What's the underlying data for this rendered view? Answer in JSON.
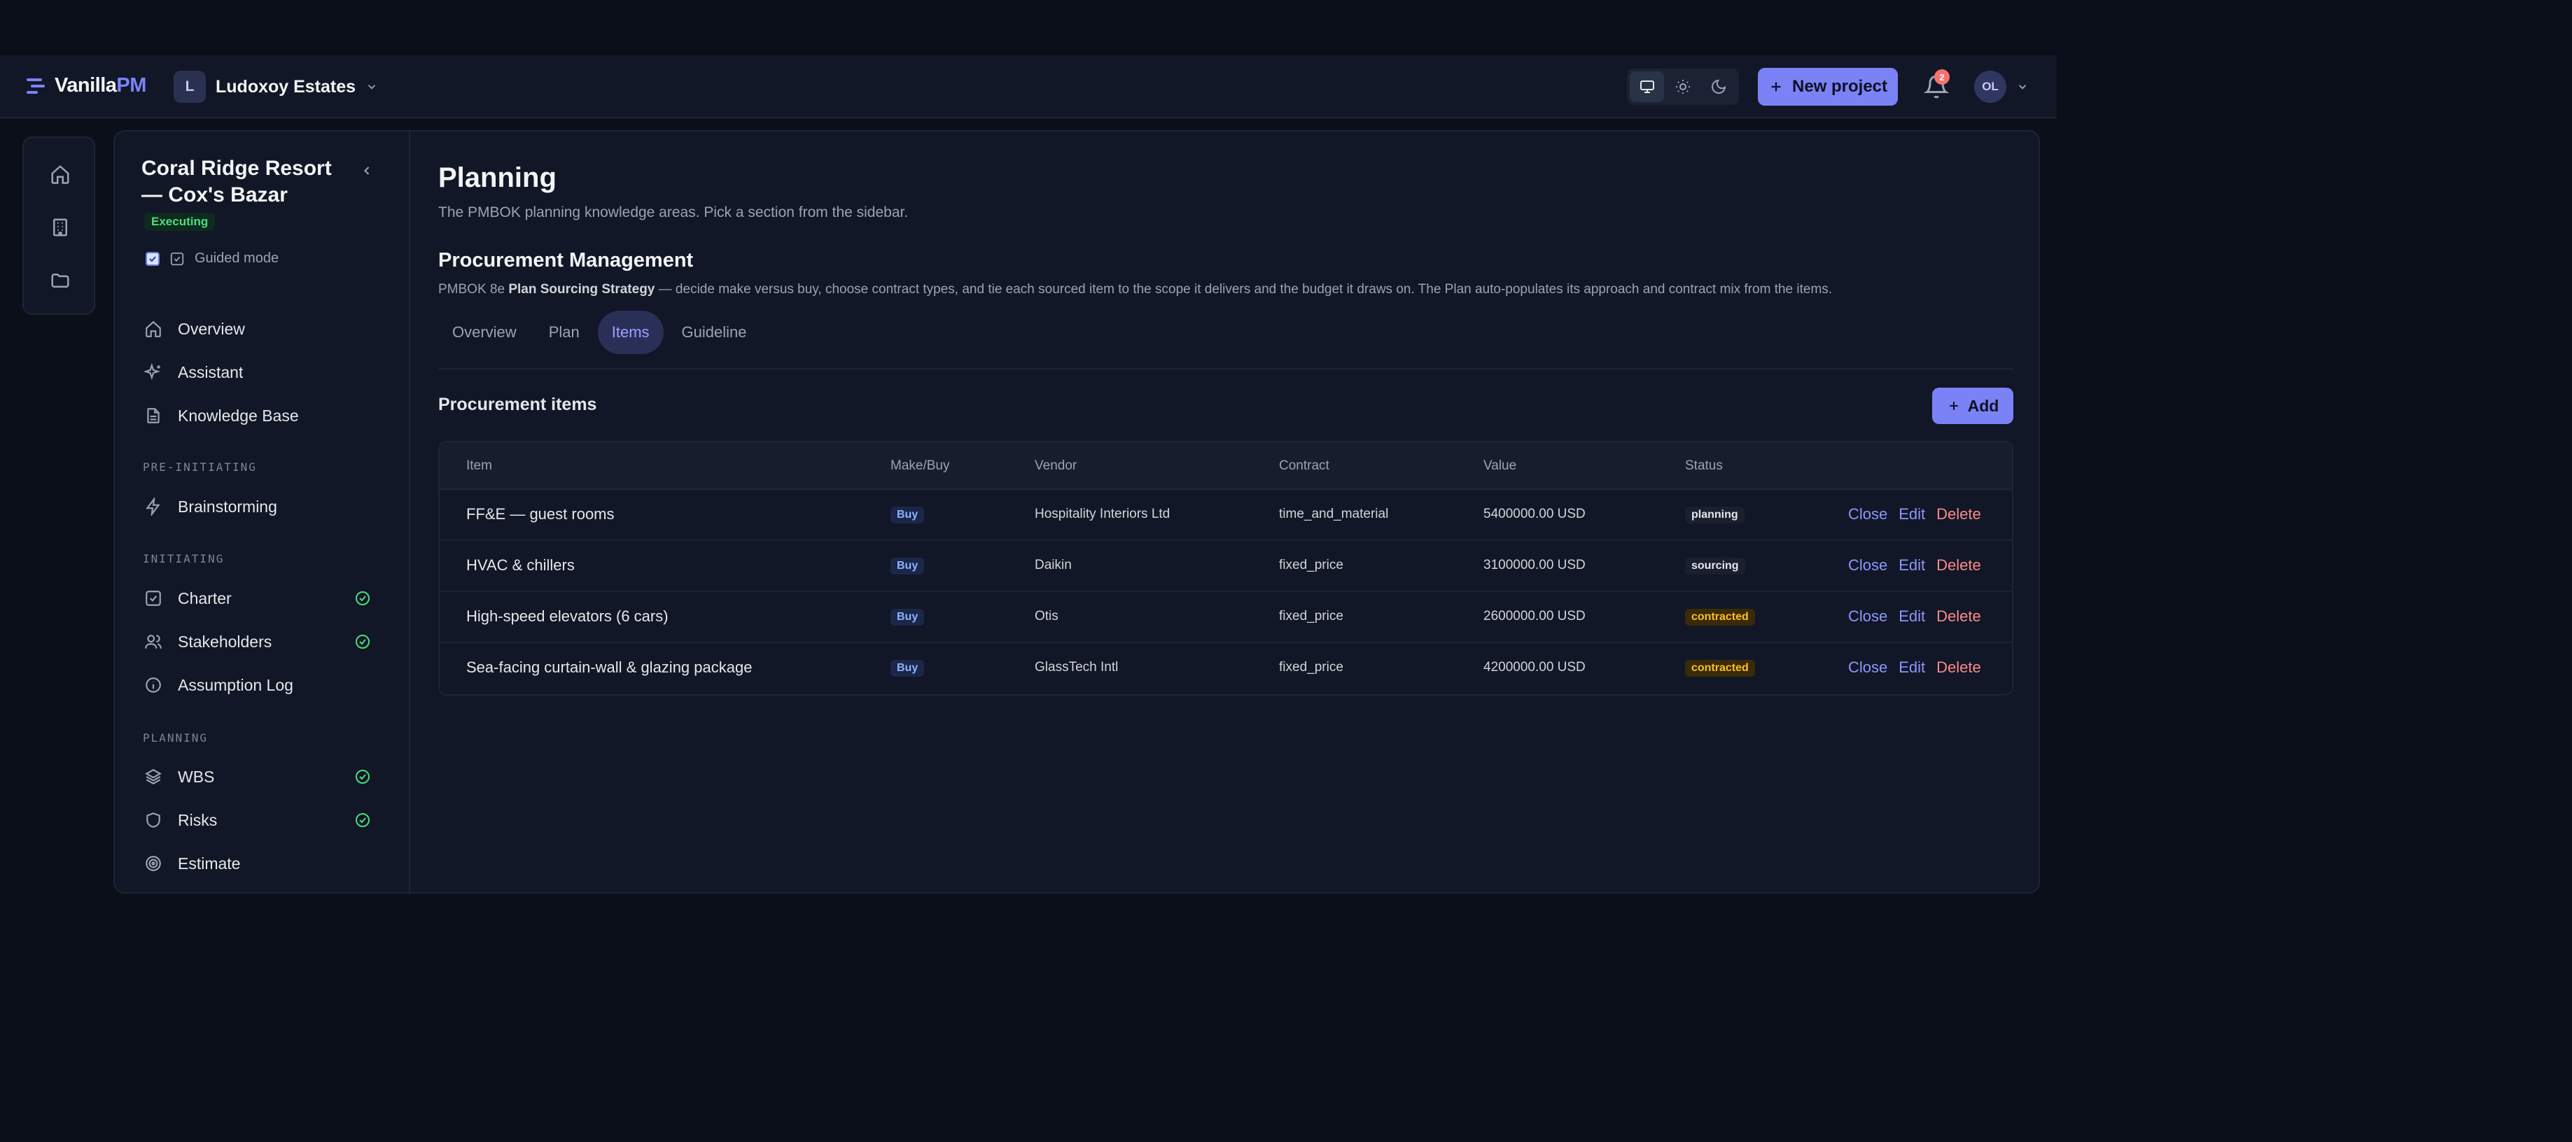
{
  "brand": {
    "name": "Vanilla",
    "name_accent": "PM"
  },
  "org": {
    "initial": "L",
    "name": "Ludoxoy Estates"
  },
  "header": {
    "new_project_label": "New project",
    "notification_count": "2",
    "user_initials": "OL"
  },
  "rail": {
    "items": [
      "home-icon",
      "building-icon",
      "folder-icon"
    ]
  },
  "project": {
    "title": "Coral Ridge Resort — Cox's Bazar",
    "status": "Executing",
    "guided_mode_label": "Guided mode",
    "guided_mode_checked": true
  },
  "sidebar": {
    "top_items": [
      {
        "label": "Overview",
        "icon": "home-icon"
      },
      {
        "label": "Assistant",
        "icon": "sparkles-icon"
      },
      {
        "label": "Knowledge Base",
        "icon": "document-icon"
      }
    ],
    "sections": [
      {
        "title": "PRE-INITIATING",
        "items": [
          {
            "label": "Brainstorming",
            "icon": "bolt-icon",
            "done": false
          }
        ]
      },
      {
        "title": "INITIATING",
        "items": [
          {
            "label": "Charter",
            "icon": "checkbox-icon",
            "done": true
          },
          {
            "label": "Stakeholders",
            "icon": "users-icon",
            "done": true
          },
          {
            "label": "Assumption Log",
            "icon": "info-icon",
            "done": false
          }
        ]
      },
      {
        "title": "PLANNING",
        "items": [
          {
            "label": "WBS",
            "icon": "layers-icon",
            "done": true
          },
          {
            "label": "Risks",
            "icon": "shield-icon",
            "done": true
          },
          {
            "label": "Estimate",
            "icon": "target-icon",
            "done": false
          }
        ]
      }
    ]
  },
  "page": {
    "title": "Planning",
    "subtitle": "The PMBOK planning knowledge areas. Pick a section from the sidebar.",
    "section_title": "Procurement Management",
    "desc_prefix": "PMBOK 8e ",
    "desc_bold": "Plan Sourcing Strategy",
    "desc_rest": " — decide make versus buy, choose contract types, and tie each sourced item to the scope it delivers and the budget it draws on. The Plan auto-populates its approach and contract mix from the items.",
    "tabs": [
      "Overview",
      "Plan",
      "Items",
      "Guideline"
    ],
    "active_tab": "Items"
  },
  "procurement": {
    "title": "Procurement items",
    "add_label": "Add",
    "columns": [
      "Item",
      "Make/Buy",
      "Vendor",
      "Contract",
      "Value",
      "Status"
    ],
    "actions": {
      "close": "Close",
      "edit": "Edit",
      "delete": "Delete"
    },
    "rows": [
      {
        "item": "FF&E — guest rooms",
        "make_buy": "Buy",
        "vendor": "Hospitality Interiors Ltd",
        "contract": "time_and_material",
        "value": "5400000.00 USD",
        "status": "planning"
      },
      {
        "item": "HVAC & chillers",
        "make_buy": "Buy",
        "vendor": "Daikin",
        "contract": "fixed_price",
        "value": "3100000.00 USD",
        "status": "sourcing"
      },
      {
        "item": "High-speed elevators (6 cars)",
        "make_buy": "Buy",
        "vendor": "Otis",
        "contract": "fixed_price",
        "value": "2600000.00 USD",
        "status": "contracted"
      },
      {
        "item": "Sea-facing curtain-wall & glazing package",
        "make_buy": "Buy",
        "vendor": "GlassTech Intl",
        "contract": "fixed_price",
        "value": "4200000.00 USD",
        "status": "contracted"
      }
    ]
  },
  "colors": {
    "accent": "#7b82f5",
    "success": "#4ade80",
    "danger": "#fb8a8a",
    "status_planning_bg": "#1a2030",
    "status_contracted_bg": "#3a2a08",
    "status_contracted_fg": "#fbbf24"
  }
}
